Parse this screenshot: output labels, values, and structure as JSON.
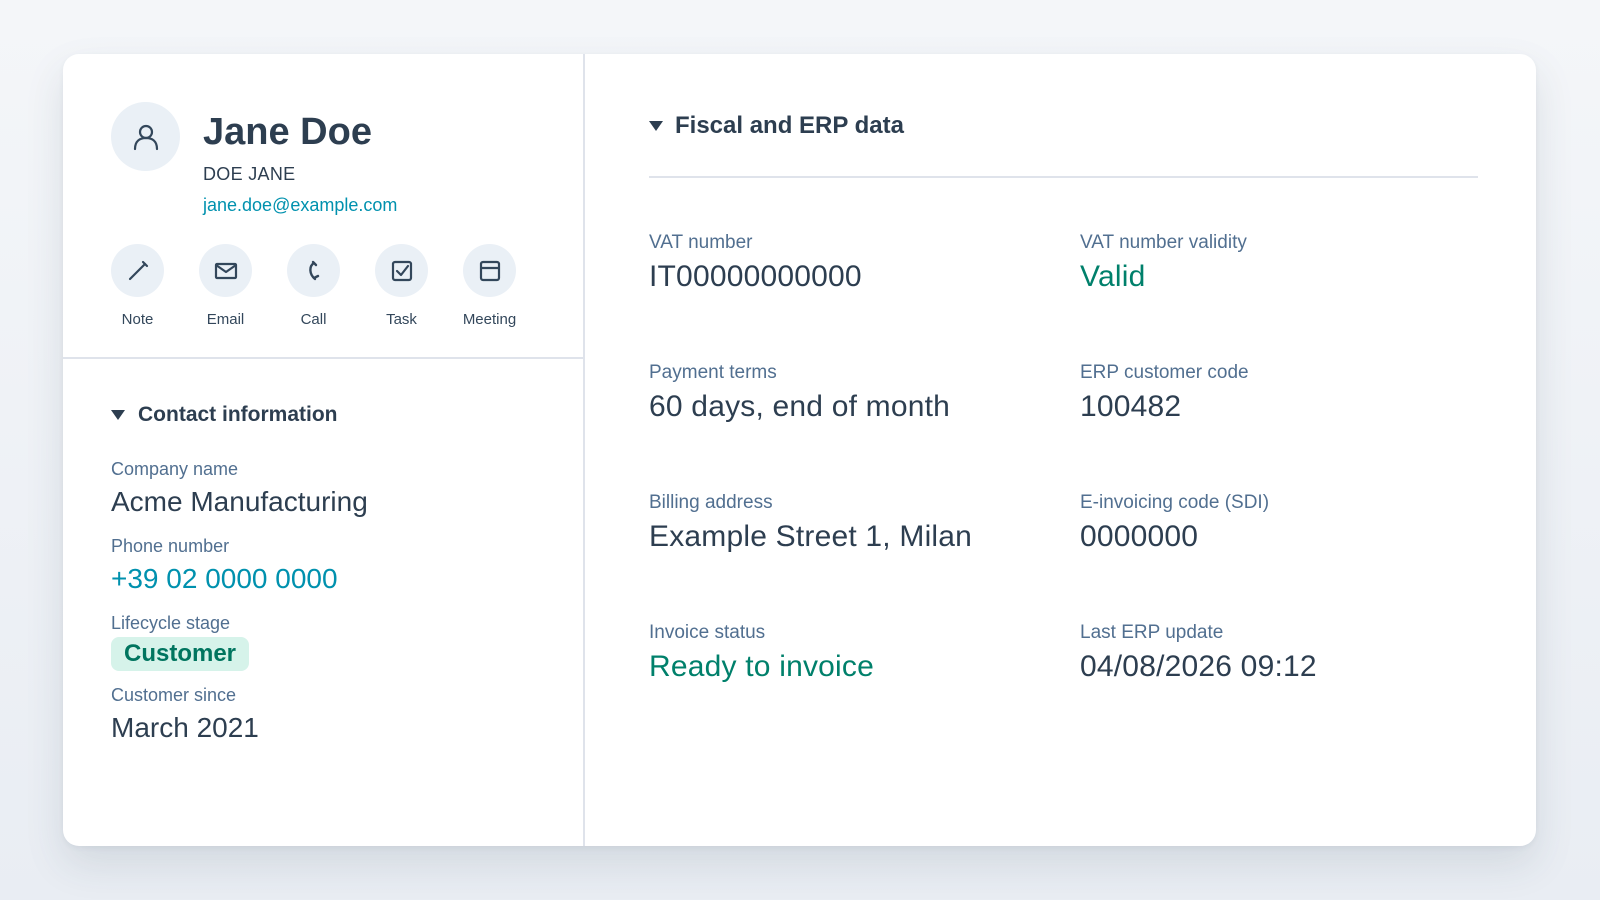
{
  "contact": {
    "full_name": "Jane Doe",
    "alt_name": "DOE JANE",
    "email": "jane.doe@example.com",
    "avatar_icon": "user-icon"
  },
  "actions": [
    {
      "label": "Note",
      "icon": "pencil-icon"
    },
    {
      "label": "Email",
      "icon": "envelope-icon"
    },
    {
      "label": "Call",
      "icon": "phone-icon"
    },
    {
      "label": "Task",
      "icon": "checkbox-icon"
    },
    {
      "label": "Meeting",
      "icon": "calendar-icon"
    }
  ],
  "contact_info": {
    "title": "Contact information",
    "company_label": "Company name",
    "company_value": "Acme Manufacturing",
    "phone_label": "Phone number",
    "phone_value": "+39 02 0000 0000",
    "lifecycle_label": "Lifecycle stage",
    "lifecycle_value": "Customer",
    "since_label": "Customer since",
    "since_value": "March 2021"
  },
  "fiscal": {
    "title": "Fiscal and ERP data",
    "fields": [
      {
        "label": "VAT number",
        "value": "IT00000000000"
      },
      {
        "label": "VAT number validity",
        "value": "Valid"
      },
      {
        "label": "Payment terms",
        "value": "60 days, end of month"
      },
      {
        "label": "ERP customer code",
        "value": "100482"
      },
      {
        "label": "Billing address",
        "value": "Example Street 1, Milan"
      },
      {
        "label": "E-invoicing code (SDI)",
        "value": "0000000"
      },
      {
        "label": "Invoice status",
        "value": "Ready to invoice"
      },
      {
        "label": "Last ERP update",
        "value": "04/08/2026 09:12"
      }
    ]
  },
  "colors": {
    "link": "#0091ae",
    "success": "#00806b",
    "badge_bg": "#d6f3ea",
    "text": "#2d3e50"
  }
}
